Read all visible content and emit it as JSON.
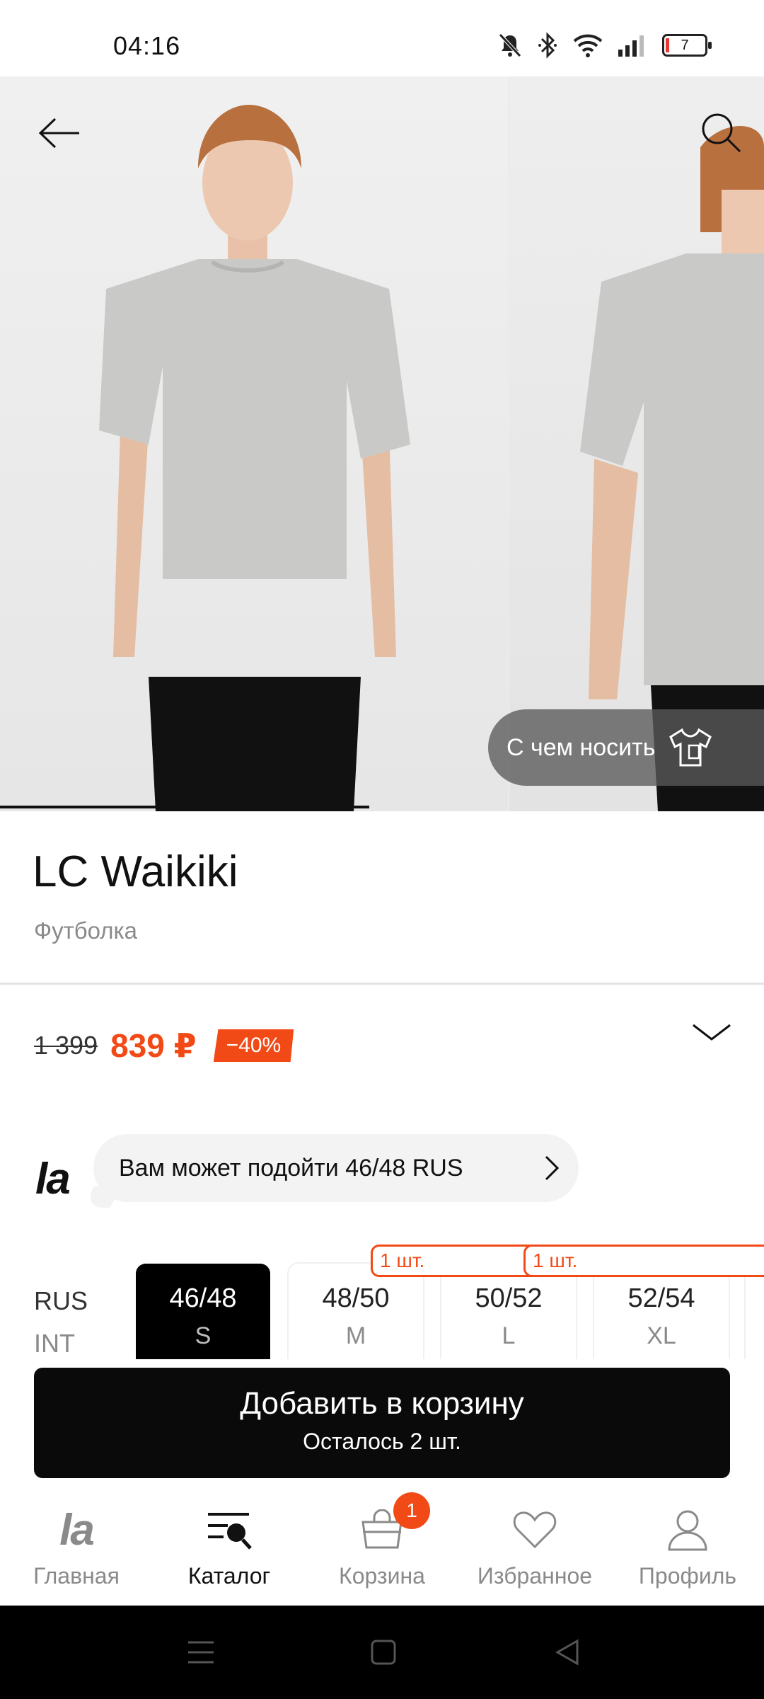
{
  "status_bar": {
    "time": "04:16",
    "battery_level": "7",
    "icons": [
      "bell-muted-icon",
      "bluetooth-icon",
      "wifi-icon",
      "signal-icon",
      "battery-icon"
    ]
  },
  "gallery": {
    "wear_with_label": "С чем носить",
    "current_image_fraction": 0.48
  },
  "product": {
    "brand": "LC Waikiki",
    "type": "Футболка",
    "old_price": "1 399",
    "new_price": "839 ₽",
    "discount": "−40%"
  },
  "fit": {
    "logo": "la",
    "suggestion": "Вам может подойти 46/48 RUS"
  },
  "sizes": {
    "system_rus": "RUS",
    "system_int": "INT",
    "items": [
      {
        "rus": "46/48",
        "int": "S",
        "badge": "",
        "selected": true
      },
      {
        "rus": "48/50",
        "int": "M",
        "badge": "1 шт.",
        "selected": false
      },
      {
        "rus": "50/52",
        "int": "L",
        "badge": "1 шт.",
        "selected": false
      },
      {
        "rus": "52/54",
        "int": "XL",
        "badge": "",
        "selected": false
      }
    ]
  },
  "cta": {
    "label": "Добавить в корзину",
    "sublabel": "Осталось 2 шт."
  },
  "nav": {
    "home": "Главная",
    "catalog": "Каталог",
    "cart": "Корзина",
    "cart_count": "1",
    "favorites": "Избранное",
    "profile": "Профиль",
    "home_logo": "la"
  },
  "colors": {
    "accent": "#f24a17",
    "primary": "#0a0a0a"
  }
}
